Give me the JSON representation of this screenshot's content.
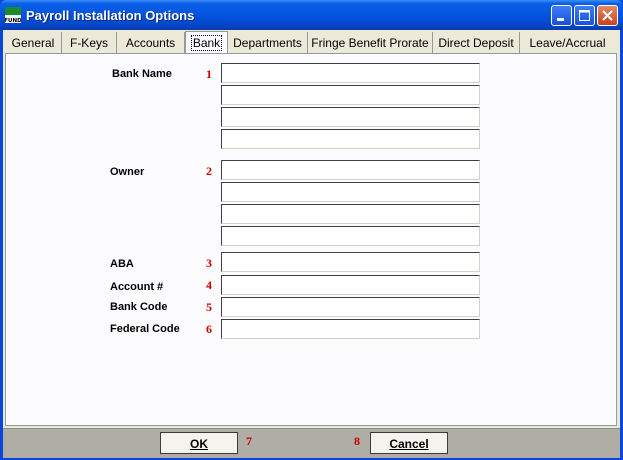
{
  "window": {
    "title": "Payroll Installation Options",
    "app_icon_text_top": "FUND",
    "app_icon_text_bottom": "FUND"
  },
  "tabs": [
    "General",
    "F-Keys",
    "Accounts",
    "Bank",
    "Departments",
    "Fringe Benefit Prorate",
    "Direct Deposit",
    "Leave/Accrual"
  ],
  "active_tab": "Bank",
  "form": {
    "bank_name_label": "Bank Name",
    "bank_name_num": "1",
    "owner_label": "Owner",
    "owner_num": "2",
    "aba_label": "ABA",
    "aba_num": "3",
    "account_label": "Account #",
    "account_num": "4",
    "bank_code_label": "Bank Code",
    "bank_code_num": "5",
    "federal_code_label": "Federal Code",
    "federal_code_num": "6"
  },
  "buttons": {
    "ok_label": "OK",
    "ok_num": "7",
    "cancel_label": "Cancel",
    "cancel_num": "8"
  },
  "colors": {
    "title_bar": "#0553e0",
    "panel": "#fcfcfe",
    "client": "#ece9d8",
    "marker": "#cc0000"
  }
}
